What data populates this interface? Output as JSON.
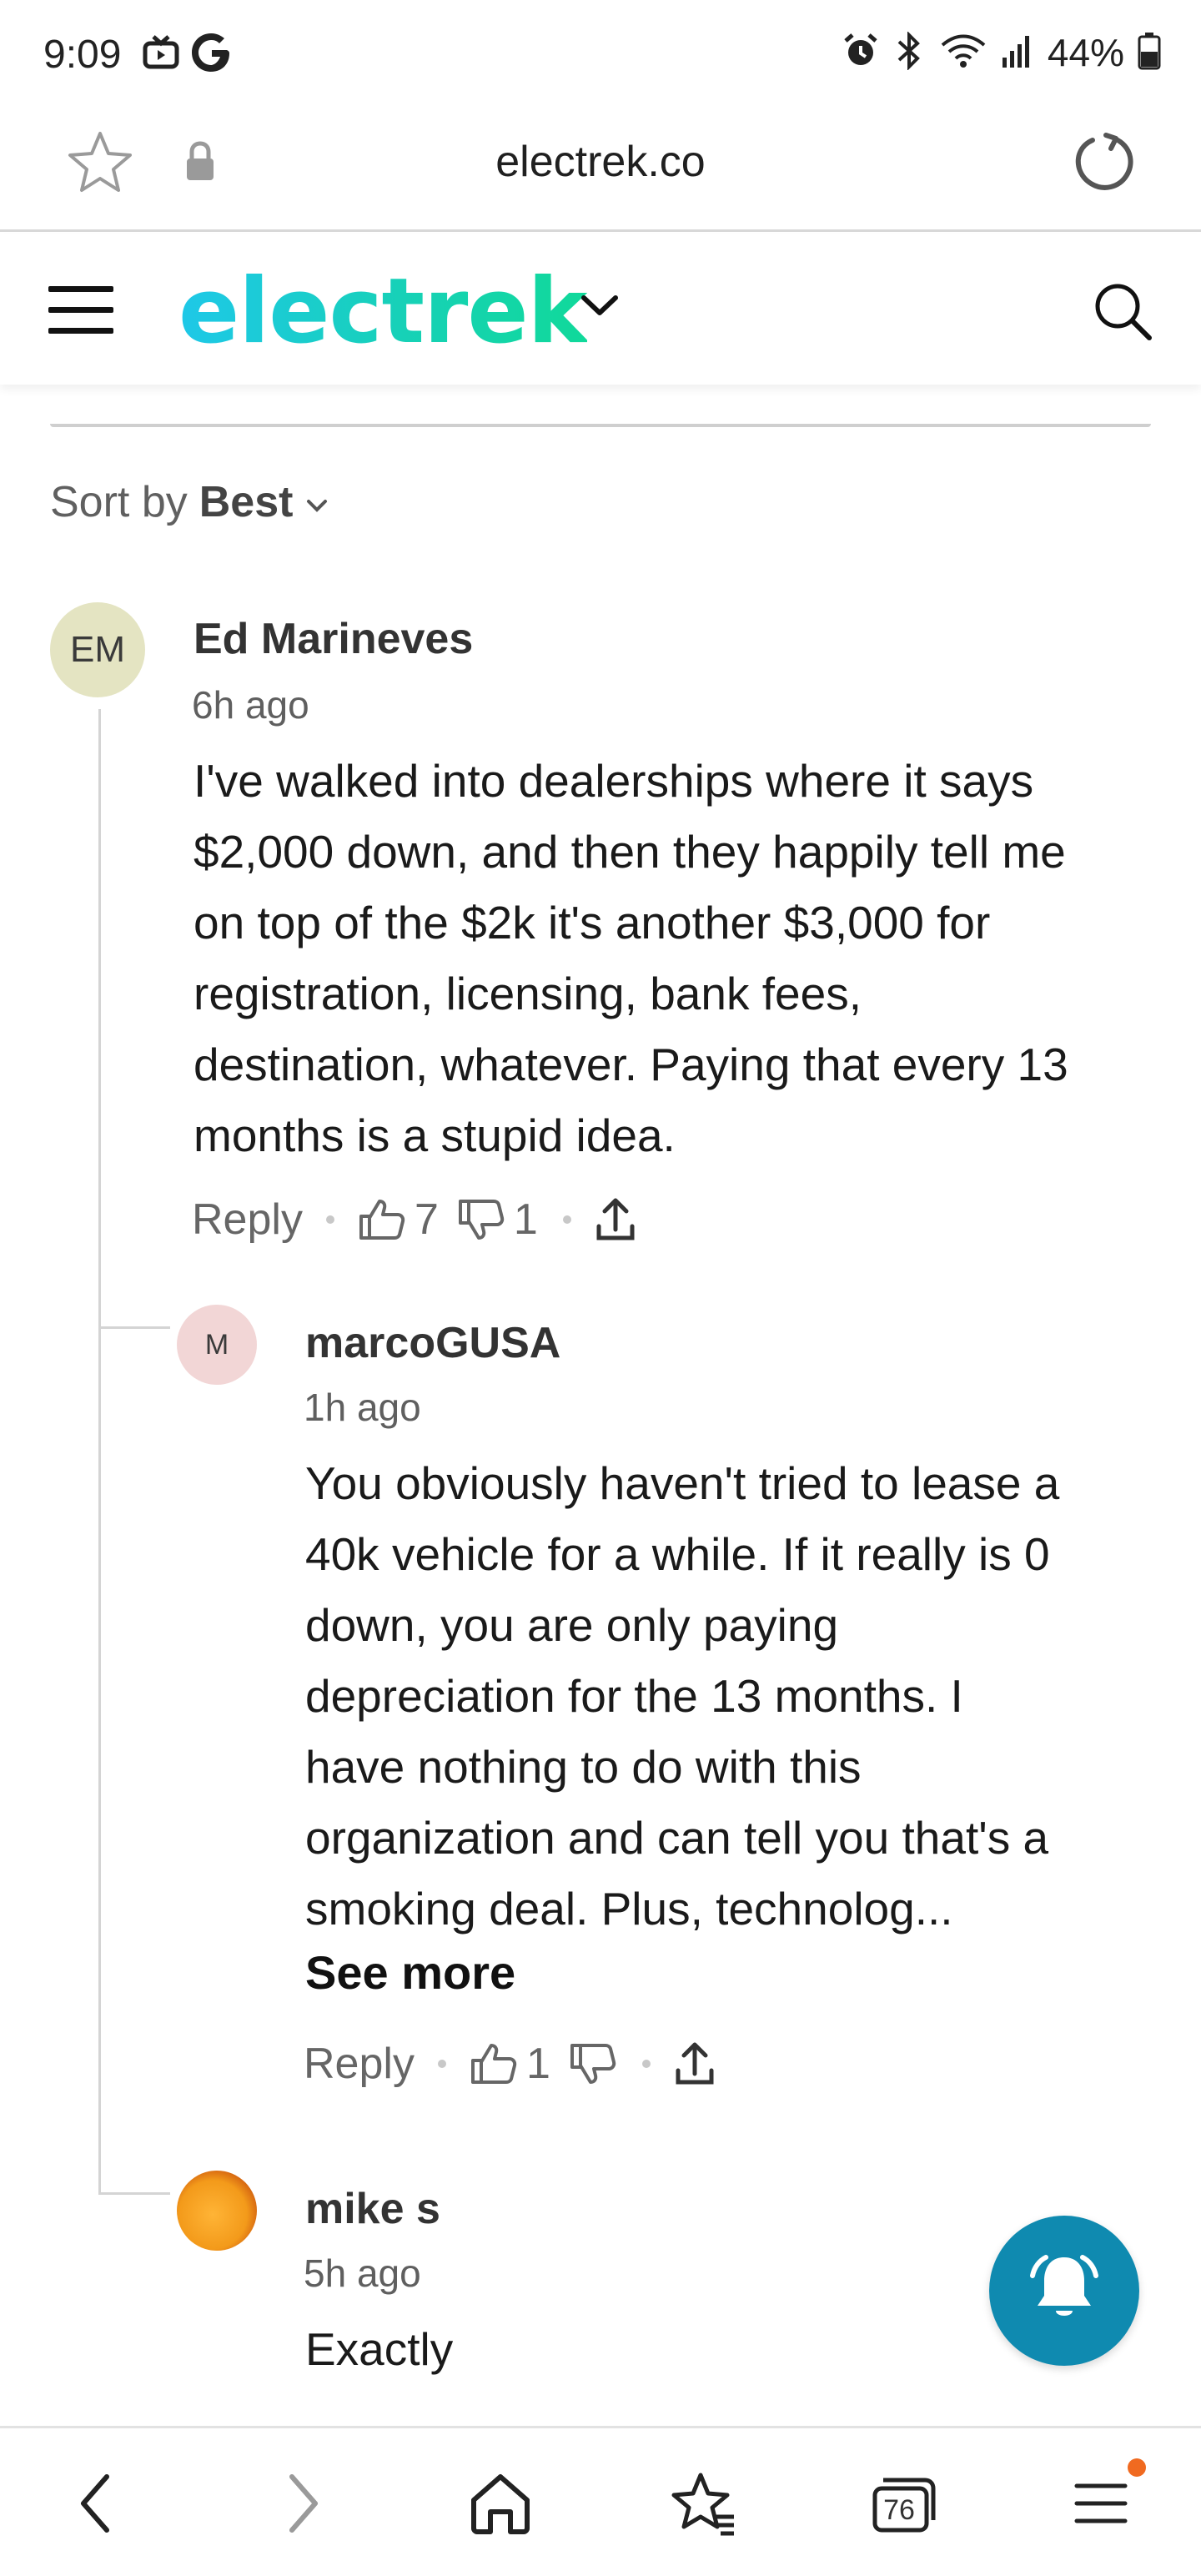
{
  "status_bar": {
    "time": "9:09",
    "battery": "44%",
    "icons": [
      "tv-icon",
      "google-icon",
      "alarm-icon",
      "bluetooth-icon",
      "wifi-icon",
      "signal-icon",
      "battery-icon"
    ]
  },
  "browser": {
    "url": "electrek.co"
  },
  "site": {
    "brand": "electrek",
    "brand_colors": [
      "#1ec8e8",
      "#10d99a"
    ]
  },
  "comments": {
    "sort_label": "Sort by",
    "sort_value": "Best",
    "items": [
      {
        "initials": "EM",
        "author": "Ed Marineves",
        "time": "6h ago",
        "lines": [
          "I've walked into dealerships where it says",
          "$2,000 down, and then they happily tell me",
          "on top of the $2k it's another $3,000 for",
          "registration, licensing, bank fees,",
          "destination, whatever. Paying that every 13",
          "months is a stupid idea."
        ],
        "reply_label": "Reply",
        "upvotes": "7",
        "downvotes": "1"
      },
      {
        "initials": "M",
        "author": "marcoGUSA",
        "time": "1h ago",
        "lines": [
          "You obviously haven't tried to lease a",
          "40k vehicle for a while. If it really is 0",
          "down, you are only paying",
          "depreciation for the 13 months. I",
          "have nothing to do with this",
          "organization and can tell you that's a",
          "smoking deal. Plus, technolog..."
        ],
        "see_more": "See more",
        "reply_label": "Reply",
        "upvotes": "1"
      },
      {
        "author": "mike s",
        "time": "5h ago",
        "lines": [
          "Exactly"
        ]
      }
    ]
  },
  "bottom_nav": {
    "tabs_count": "76"
  },
  "colors": {
    "accent_fab": "#0f8ab0",
    "menu_badge": "#f06a20"
  }
}
